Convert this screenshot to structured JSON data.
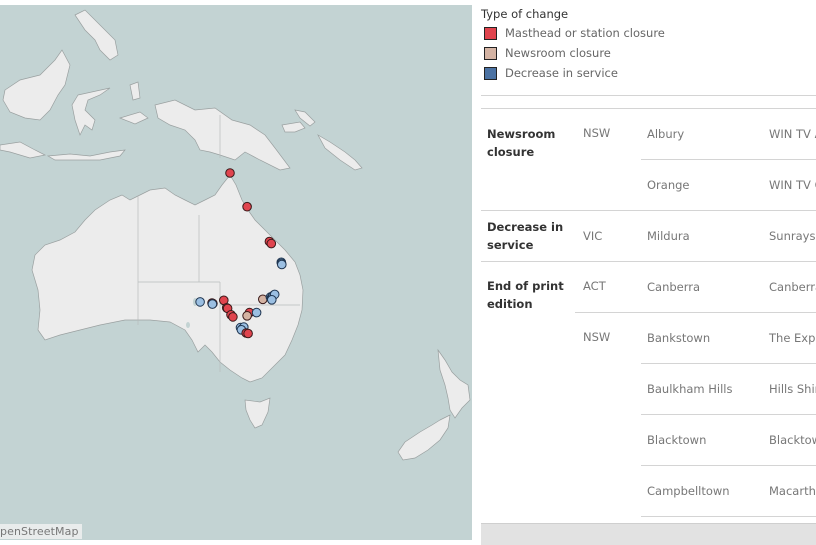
{
  "map": {
    "attribution": "penStreetMap",
    "colors": {
      "water": "#c3d3d3",
      "land": "#ececec",
      "coast": "#9aa0a0"
    },
    "markers": [
      {
        "type": "masthead",
        "lon": 142.2,
        "lat": -10.6
      },
      {
        "type": "masthead",
        "lon": 145.8,
        "lat": -16.9
      },
      {
        "type": "masthead",
        "lon": 150.5,
        "lat": -23.4
      },
      {
        "type": "masthead",
        "lon": 150.9,
        "lat": -23.8
      },
      {
        "type": "decrease",
        "lon": 153.0,
        "lat": -27.3
      },
      {
        "type": "decrease",
        "lon": 153.05,
        "lat": -27.5
      },
      {
        "type": "decrease",
        "lon": 153.1,
        "lat": -27.7
      },
      {
        "type": "decrease",
        "lon": 135.9,
        "lat": -34.7
      },
      {
        "type": "masthead",
        "lon": 138.4,
        "lat": -34.9
      },
      {
        "type": "masthead",
        "lon": 138.6,
        "lat": -35.0
      },
      {
        "type": "decrease",
        "lon": 138.5,
        "lat": -35.1
      },
      {
        "type": "masthead",
        "lon": 140.9,
        "lat": -34.4
      },
      {
        "type": "masthead",
        "lon": 141.5,
        "lat": -35.8
      },
      {
        "type": "masthead",
        "lon": 141.7,
        "lat": -35.9
      },
      {
        "type": "masthead",
        "lon": 142.4,
        "lat": -37.1
      },
      {
        "type": "masthead",
        "lon": 142.8,
        "lat": -37.5
      },
      {
        "type": "masthead",
        "lon": 146.3,
        "lat": -36.7
      },
      {
        "type": "newsroom",
        "lon": 145.8,
        "lat": -37.3
      },
      {
        "type": "decrease",
        "lon": 147.8,
        "lat": -36.7
      },
      {
        "type": "newsroom",
        "lon": 149.1,
        "lat": -34.2
      },
      {
        "type": "decrease",
        "lon": 150.7,
        "lat": -33.8
      },
      {
        "type": "decrease",
        "lon": 150.9,
        "lat": -34.0
      },
      {
        "type": "decrease",
        "lon": 151.1,
        "lat": -33.7
      },
      {
        "type": "decrease",
        "lon": 151.3,
        "lat": -33.5
      },
      {
        "type": "decrease",
        "lon": 151.6,
        "lat": -33.3
      },
      {
        "type": "decrease",
        "lon": 151.0,
        "lat": -34.3
      },
      {
        "type": "decrease",
        "lon": 144.4,
        "lat": -39.5
      },
      {
        "type": "decrease",
        "lon": 144.8,
        "lat": -39.7
      },
      {
        "type": "decrease",
        "lon": 145.1,
        "lat": -39.4
      },
      {
        "type": "decrease",
        "lon": 144.6,
        "lat": -39.9
      },
      {
        "type": "masthead",
        "lon": 145.6,
        "lat": -40.5
      },
      {
        "type": "masthead",
        "lon": 146.0,
        "lat": -40.6
      }
    ]
  },
  "legend": {
    "title": "Type of change",
    "items": [
      {
        "key": "masthead",
        "label": "Masthead or station closure",
        "color": "#e0444e"
      },
      {
        "key": "newsroom",
        "label": "Newsroom closure",
        "color": "#d4b3a3"
      },
      {
        "key": "decrease",
        "label": "Decrease in service",
        "color": "#4b72a3"
      }
    ],
    "marker_fill": {
      "masthead": "#e0444e",
      "newsroom": "#d4b3a3",
      "decrease": "#9bbfe2"
    }
  },
  "table": {
    "groups": [
      {
        "type": "Newsroom closure",
        "states": [
          {
            "state": "NSW",
            "rows": [
              {
                "town": "Albury",
                "outlet": "WIN TV Albury"
              },
              {
                "town": "Orange",
                "outlet": "WIN TV Orange"
              }
            ]
          }
        ]
      },
      {
        "type": "Decrease in service",
        "states": [
          {
            "state": "VIC",
            "rows": [
              {
                "town": "Mildura",
                "outlet": "Sunraysia Daily"
              }
            ]
          }
        ]
      },
      {
        "type": "End of print edition",
        "states": [
          {
            "state": "ACT",
            "rows": [
              {
                "town": "Canberra",
                "outlet": "Canberra Chronicle"
              }
            ]
          },
          {
            "state": "NSW",
            "rows": [
              {
                "town": "Bankstown",
                "outlet": "The Express"
              },
              {
                "town": "Baulkham Hills",
                "outlet": "Hills Shire Times"
              },
              {
                "town": "Blacktown",
                "outlet": "Blacktown Advocate"
              },
              {
                "town": "Campbelltown",
                "outlet": "Macarthur Chronicle"
              }
            ]
          }
        ]
      }
    ]
  }
}
